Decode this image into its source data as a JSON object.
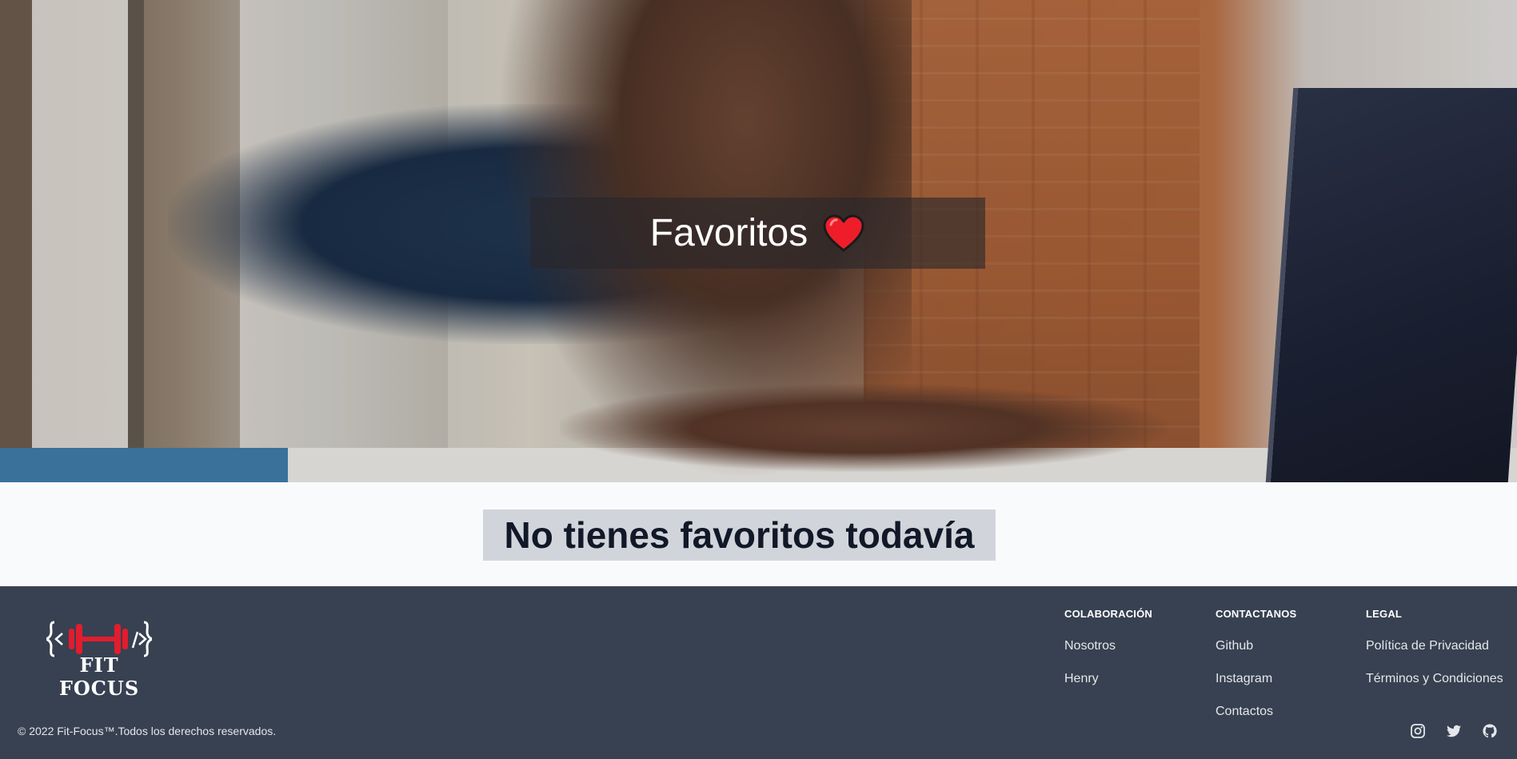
{
  "hero": {
    "title": "Favoritos",
    "heart_icon": "heart-icon"
  },
  "main": {
    "empty_message": "No tienes favoritos todavía"
  },
  "footer": {
    "logo": {
      "text": "FIT FOCUS",
      "icon": "dumbbell-code-icon"
    },
    "columns": [
      {
        "heading": "COLABORACIÓN",
        "links": [
          "Nosotros",
          "Henry"
        ]
      },
      {
        "heading": "CONTACTANOS",
        "links": [
          "Github",
          "Instagram",
          "Contactos"
        ]
      },
      {
        "heading": "LEGAL",
        "links": [
          "Política de Privacidad",
          "Términos y Condiciones"
        ]
      }
    ],
    "copyright": "© 2022 Fit-Focus™.Todos los derechos reservados.",
    "social_icons": [
      "instagram-icon",
      "twitter-icon",
      "github-icon"
    ]
  },
  "colors": {
    "footer_bg": "#374151",
    "page_bg": "#f9fafb",
    "empty_box_bg": "#d1d5db",
    "brand_red": "#e11d2e",
    "heart_red": "#ef1d2a"
  }
}
